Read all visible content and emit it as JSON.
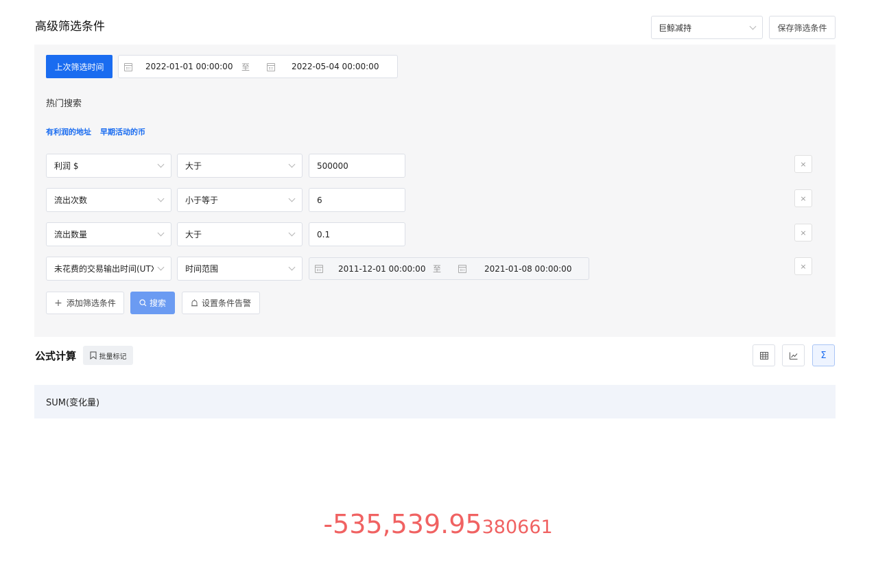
{
  "header": {
    "title": "高级筛选条件",
    "preset_value": "巨鲸减持",
    "save_label": "保存筛选条件"
  },
  "time_filter": {
    "button_label": "上次筛选时间",
    "start": "2022-01-01 00:00:00",
    "separator": "至",
    "end": "2022-05-04 00:00:00"
  },
  "hot_search": {
    "label": "热门搜索",
    "links": [
      "有利润的地址",
      "早期活动的币"
    ]
  },
  "conditions": [
    {
      "field": "利润 $",
      "operator": "大于",
      "value": "500000"
    },
    {
      "field": "流出次数",
      "operator": "小于等于",
      "value": "6"
    },
    {
      "field": "流出数量",
      "operator": "大于",
      "value": "0.1"
    },
    {
      "field": "未花费的交易输出时间(UTXO)",
      "operator": "时间范围",
      "range_start": "2011-12-01 00:00:00",
      "range_separator": "至",
      "range_end": "2021-01-08 00:00:00"
    }
  ],
  "close_symbol": "×",
  "actions": {
    "add_label": "添加筛选条件",
    "add_symbol": "+",
    "search_label": "搜索",
    "alert_label": "设置条件告警"
  },
  "formula": {
    "title": "公式计算",
    "batch_label": "批量标记",
    "views": [
      {
        "icon": "table-icon",
        "glyph": "▦"
      },
      {
        "icon": "line-chart-icon",
        "glyph": "⟀"
      },
      {
        "icon": "sigma-icon",
        "glyph": "Σ"
      }
    ],
    "expression": "SUM(变化量)"
  },
  "result": {
    "main": "-535,539.95",
    "tail": "380661"
  },
  "colors": {
    "primary": "#1a6cf0",
    "result": "#f06262",
    "panel_bg": "#f6f6f7"
  }
}
